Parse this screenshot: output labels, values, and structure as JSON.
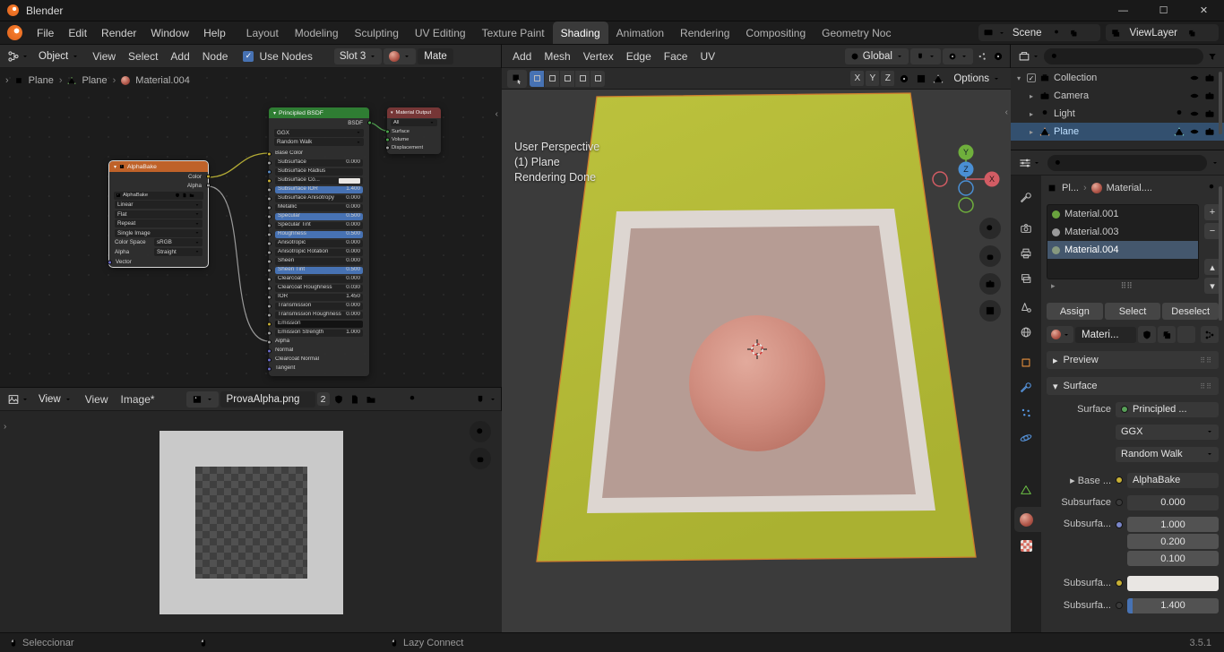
{
  "colors": {
    "accent": "#4772b3",
    "selection": "#33506f",
    "texture_node": "#bf6229",
    "shader_node": "#2f7d33",
    "output_node": "#763636",
    "plane": "#b3ba37",
    "ground": "#b69c94",
    "sphere": "#d08d7f",
    "wire_color": "#b3ab35",
    "wire_alpha": "#9a9a9a",
    "wire_bsdf": "#4e9a4e"
  },
  "icons": {
    "disclosure": "▸",
    "disclosure_open": "▾",
    "collapse_left": "‹",
    "collapse_right": "›",
    "crumb_sep": "›",
    "plus": "+",
    "minus": "−",
    "up": "▴",
    "down": "▾",
    "grip": "⠿⠿",
    "check": "✓"
  },
  "window": {
    "title": "Blender",
    "minimize": "—",
    "maximize": "☐",
    "close": "✕"
  },
  "topbar": {
    "menus": [
      "File",
      "Edit",
      "Render",
      "Window",
      "Help"
    ],
    "workspaces": [
      {
        "label": "Layout"
      },
      {
        "label": "Modeling"
      },
      {
        "label": "Sculpting"
      },
      {
        "label": "UV Editing"
      },
      {
        "label": "Texture Paint"
      },
      {
        "label": "Shading",
        "cls": "active"
      },
      {
        "label": "Animation"
      },
      {
        "label": "Rendering"
      },
      {
        "label": "Compositing"
      },
      {
        "label": "Geometry Noc"
      }
    ],
    "scene": "Scene",
    "viewlayer": "ViewLayer"
  },
  "shader": {
    "mode": "Object",
    "menus": [
      "View",
      "Select",
      "Add",
      "Node"
    ],
    "use_nodes": "Use Nodes",
    "slot": "Slot 3",
    "material_name": "Mate",
    "path": {
      "object": "Plane",
      "mesh": "Plane",
      "material": "Material.004"
    }
  },
  "nodes": {
    "alphabake": {
      "title": "AlphaBake",
      "outputs": [
        {
          "label": "Color",
          "sock": "sock-yellow"
        },
        {
          "label": "Alpha",
          "sock": "sock-gray"
        }
      ],
      "image_name": "AlphaBake",
      "dropdowns": [
        "Linear",
        "Flat",
        "Repeat",
        "Single Image"
      ],
      "color_space_label": "Color Space",
      "color_space": "sRGB",
      "alpha_label": "Alpha",
      "alpha_mode": "Straight",
      "vector_input": "Vector"
    },
    "principled": {
      "title": "Principled BSDF",
      "output": "BSDF",
      "distribution": "GGX",
      "sss_method": "Random Walk",
      "params": [
        {
          "label": "Base Color",
          "kind": "link",
          "sock": "sock-yellow"
        },
        {
          "label": "Subsurface",
          "value": "0.000",
          "sock": "sock-gray"
        },
        {
          "label": "Subsurface Radius",
          "kind": "button",
          "sock": "sock-blue"
        },
        {
          "label": "Subsurface Co...",
          "kind": "swatch-light",
          "sock": "sock-yellow"
        },
        {
          "label": "Subsurface IOR",
          "value": "1.400",
          "sock": "sock-gray",
          "fill": "fill-full"
        },
        {
          "label": "Subsurface Anisotropy",
          "value": "0.000",
          "sock": "sock-gray"
        },
        {
          "label": "Metallic",
          "value": "0.000",
          "sock": "sock-gray"
        },
        {
          "label": "Specular",
          "value": "0.500",
          "sock": "sock-gray",
          "fill": "fill-full"
        },
        {
          "label": "Specular Tint",
          "value": "0.000",
          "sock": "sock-gray"
        },
        {
          "label": "Roughness",
          "value": "0.500",
          "sock": "sock-gray",
          "fill": "fill-full"
        },
        {
          "label": "Anisotropic",
          "value": "0.000",
          "sock": "sock-gray"
        },
        {
          "label": "Anisotropic Rotation",
          "value": "0.000",
          "sock": "sock-gray"
        },
        {
          "label": "Sheen",
          "value": "0.000",
          "sock": "sock-gray"
        },
        {
          "label": "Sheen Tint",
          "value": "0.500",
          "sock": "sock-gray",
          "fill": "fill-full"
        },
        {
          "label": "Clearcoat",
          "value": "0.000",
          "sock": "sock-gray"
        },
        {
          "label": "Clearcoat Roughness",
          "value": "0.030",
          "sock": "sock-gray"
        },
        {
          "label": "IOR",
          "value": "1.450",
          "sock": "sock-gray"
        },
        {
          "label": "Transmission",
          "value": "0.000",
          "sock": "sock-gray"
        },
        {
          "label": "Transmission Roughness",
          "value": "0.000",
          "sock": "sock-gray"
        },
        {
          "label": "Emission",
          "kind": "swatch-dark",
          "sock": "sock-yellow"
        },
        {
          "label": "Emission Strength",
          "value": "1.000",
          "sock": "sock-gray"
        },
        {
          "label": "Alpha",
          "kind": "link",
          "sock": "sock-gray"
        },
        {
          "label": "Normal",
          "kind": "link",
          "sock": "sock-purple"
        },
        {
          "label": "Clearcoat Normal",
          "kind": "link",
          "sock": "sock-purple"
        },
        {
          "label": "Tangent",
          "kind": "link",
          "sock": "sock-purple"
        }
      ]
    },
    "material_output": {
      "title": "Material Output",
      "target": "All",
      "inputs": [
        {
          "label": "Surface",
          "sock": "sock-green"
        },
        {
          "label": "Volume",
          "sock": "sock-green"
        },
        {
          "label": "Displacement",
          "sock": "sock-gray"
        }
      ]
    }
  },
  "viewport": {
    "menus": [
      "Add",
      "Mesh",
      "Vertex",
      "Edge",
      "Face",
      "UV"
    ],
    "orientation": "Global",
    "axes": [
      "X",
      "Y",
      "Z"
    ],
    "options": "Options",
    "overlay": {
      "l1": "User Perspective",
      "l2": "(1) Plane",
      "l3": "Rendering Done"
    },
    "gizmo": {
      "x": "X",
      "y": "Y",
      "z": "Z"
    }
  },
  "image_editor": {
    "mode": "View",
    "menus": [
      "View",
      "Image*"
    ],
    "image_name": "ProvaAlpha.png",
    "users": "2"
  },
  "outliner": {
    "items": [
      {
        "name": "Collection"
      },
      {
        "name": "Camera"
      },
      {
        "name": "Light"
      },
      {
        "name": "Plane"
      }
    ]
  },
  "properties": {
    "path_object": "Pl...",
    "path_material": "Material....",
    "slots": [
      {
        "name": "Material.001",
        "dot": "dot-green"
      },
      {
        "name": "Material.003",
        "dot": "dot-gray"
      },
      {
        "name": "Material.004",
        "dot": "dot-sage",
        "cls": "selected"
      }
    ],
    "assign": "Assign",
    "select": "Select",
    "deselect": "Deselect",
    "datablock": "Materi...",
    "panel_preview": "Preview",
    "panel_surface": "Surface",
    "surface_label": "Surface",
    "surface_shader": "Principled ...",
    "distribution": "GGX",
    "sss_method": "Random Walk",
    "base_label": "Base ...",
    "base_value": "AlphaBake",
    "subsurface_label": "Subsurface",
    "subsurface_value": "0.000",
    "radius_label": "Subsurfa...",
    "radius_values": [
      "1.000",
      "0.200",
      "0.100"
    ],
    "color_label": "Subsurfa...",
    "ior_label": "Subsurfa...",
    "ior_value": "1.400"
  },
  "statusbar": {
    "tool": "Seleccionar",
    "hint": "Lazy Connect",
    "version": "3.5.1"
  }
}
